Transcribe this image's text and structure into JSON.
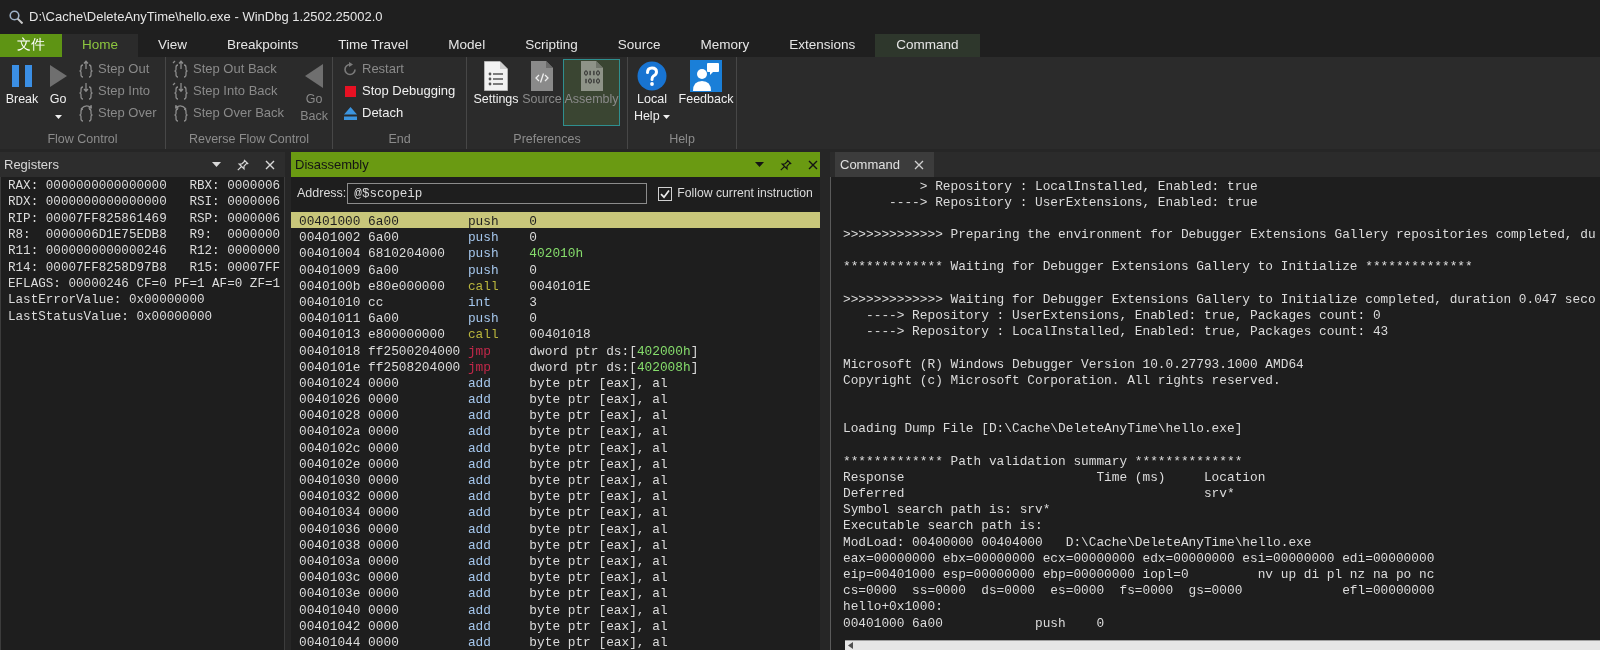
{
  "window": {
    "title": "D:\\Cache\\DeleteAnyTime\\hello.exe - WinDbg 1.2502.25002.0"
  },
  "ribbon": {
    "tabs": [
      {
        "label": "文件",
        "kind": "file",
        "selected": false
      },
      {
        "label": "Home",
        "kind": "normal",
        "selected": true
      },
      {
        "label": "View",
        "kind": "normal",
        "selected": false
      },
      {
        "label": "Breakpoints",
        "kind": "normal",
        "selected": false
      },
      {
        "label": "Time Travel",
        "kind": "normal",
        "selected": false
      },
      {
        "label": "Model",
        "kind": "normal",
        "selected": false
      },
      {
        "label": "Scripting",
        "kind": "normal",
        "selected": false
      },
      {
        "label": "Source",
        "kind": "normal",
        "selected": false
      },
      {
        "label": "Memory",
        "kind": "normal",
        "selected": false
      },
      {
        "label": "Extensions",
        "kind": "normal",
        "selected": false
      },
      {
        "label": "Command",
        "kind": "contextual",
        "selected": false
      }
    ],
    "groups": [
      {
        "label": "Flow Control",
        "buttons": [
          {
            "label": "Break",
            "kind": "large",
            "disabled": false,
            "dropdown": false,
            "checked": false
          },
          {
            "label": "Go",
            "kind": "large",
            "disabled": false,
            "dropdown": true,
            "checked": false
          },
          {
            "label": "Step Out",
            "kind": "small",
            "disabled": true,
            "dropdown": false,
            "checked": false
          },
          {
            "label": "Step Into",
            "kind": "small",
            "disabled": true,
            "dropdown": false,
            "checked": false
          },
          {
            "label": "Step Over",
            "kind": "small",
            "disabled": true,
            "dropdown": false,
            "checked": false
          }
        ]
      },
      {
        "label": "Reverse Flow Control",
        "buttons": [
          {
            "label": "Step Out Back",
            "kind": "small",
            "disabled": true,
            "dropdown": false,
            "checked": false
          },
          {
            "label": "Step Into Back",
            "kind": "small",
            "disabled": true,
            "dropdown": false,
            "checked": false
          },
          {
            "label": "Step Over Back",
            "kind": "small",
            "disabled": true,
            "dropdown": false,
            "checked": false
          },
          {
            "label": "Go Back",
            "kind": "large",
            "disabled": true,
            "dropdown": false,
            "checked": false
          }
        ]
      },
      {
        "label": "End",
        "buttons": [
          {
            "label": "Restart",
            "kind": "small",
            "disabled": true,
            "dropdown": false,
            "checked": false
          },
          {
            "label": "Stop Debugging",
            "kind": "small",
            "disabled": false,
            "dropdown": false,
            "checked": false
          },
          {
            "label": "Detach",
            "kind": "small",
            "disabled": false,
            "dropdown": false,
            "checked": false
          }
        ]
      },
      {
        "label": "Preferences",
        "buttons": [
          {
            "label": "Settings",
            "kind": "large",
            "disabled": false,
            "dropdown": false,
            "checked": false
          },
          {
            "label": "Source",
            "kind": "large",
            "disabled": true,
            "dropdown": false,
            "checked": false
          },
          {
            "label": "Assembly",
            "kind": "large",
            "disabled": true,
            "dropdown": false,
            "checked": true
          }
        ]
      },
      {
        "label": "Help",
        "buttons": [
          {
            "label": "Local Help",
            "kind": "large",
            "disabled": false,
            "dropdown": true,
            "checked": false
          },
          {
            "label": "Feedback",
            "kind": "large",
            "disabled": false,
            "dropdown": false,
            "checked": false
          }
        ]
      }
    ]
  },
  "registers": {
    "title": "Registers",
    "focused": false,
    "lines": [
      "RAX: 0000000000000000   RBX: 0000006",
      "RDX: 0000000000000000   RSI: 0000006",
      "RIP: 00007FF825861469   RSP: 0000006",
      "R8:  0000006D1E75EDB8   R9:  0000000",
      "R11: 0000000000000246   R12: 0000000",
      "R14: 00007FF8258D97B8   R15: 00007FF",
      "EFLAGS: 00000246 CF=0 PF=1 AF=0 ZF=1",
      "LastErrorValue: 0x00000000",
      "LastStatusValue: 0x00000000"
    ]
  },
  "disassembly": {
    "title": "Disassembly",
    "focused": true,
    "address": {
      "label": "Address:",
      "value": "@$scopeip"
    },
    "follow": {
      "label": "Follow current instruction",
      "checked": true
    },
    "rows": [
      {
        "address": "00401000",
        "bytes": "6a00",
        "mnemonic": "push",
        "kind": "basic",
        "operand": [
          {
            "text": "0",
            "kind": "plain"
          }
        ],
        "selected": true
      },
      {
        "address": "00401002",
        "bytes": "6a00",
        "mnemonic": "push",
        "kind": "basic",
        "operand": [
          {
            "text": "0",
            "kind": "plain"
          }
        ],
        "selected": false
      },
      {
        "address": "00401004",
        "bytes": "6810204000",
        "mnemonic": "push",
        "kind": "basic",
        "operand": [
          {
            "text": "402010h",
            "kind": "number"
          }
        ],
        "selected": false
      },
      {
        "address": "00401009",
        "bytes": "6a00",
        "mnemonic": "push",
        "kind": "basic",
        "operand": [
          {
            "text": "0",
            "kind": "plain"
          }
        ],
        "selected": false
      },
      {
        "address": "0040100b",
        "bytes": "e80e000000",
        "mnemonic": "call",
        "kind": "call",
        "operand": [
          {
            "text": "0040101E",
            "kind": "plain"
          }
        ],
        "selected": false
      },
      {
        "address": "00401010",
        "bytes": "cc",
        "mnemonic": "int",
        "kind": "basic",
        "operand": [
          {
            "text": "3",
            "kind": "plain"
          }
        ],
        "selected": false
      },
      {
        "address": "00401011",
        "bytes": "6a00",
        "mnemonic": "push",
        "kind": "basic",
        "operand": [
          {
            "text": "0",
            "kind": "plain"
          }
        ],
        "selected": false
      },
      {
        "address": "00401013",
        "bytes": "e800000000",
        "mnemonic": "call",
        "kind": "call",
        "operand": [
          {
            "text": "00401018",
            "kind": "plain"
          }
        ],
        "selected": false
      },
      {
        "address": "00401018",
        "bytes": "ff2500204000",
        "mnemonic": "jmp",
        "kind": "jump",
        "operand": [
          {
            "text": "dword ptr ds:[",
            "kind": "plain"
          },
          {
            "text": "402000h",
            "kind": "number"
          },
          {
            "text": "]",
            "kind": "plain"
          }
        ],
        "selected": false
      },
      {
        "address": "0040101e",
        "bytes": "ff2508204000",
        "mnemonic": "jmp",
        "kind": "jump",
        "operand": [
          {
            "text": "dword ptr ds:[",
            "kind": "plain"
          },
          {
            "text": "402008h",
            "kind": "number"
          },
          {
            "text": "]",
            "kind": "plain"
          }
        ],
        "selected": false
      },
      {
        "address": "00401024",
        "bytes": "0000",
        "mnemonic": "add",
        "kind": "basic",
        "operand": [
          {
            "text": "byte ptr [eax], al",
            "kind": "plain"
          }
        ],
        "selected": false
      },
      {
        "address": "00401026",
        "bytes": "0000",
        "mnemonic": "add",
        "kind": "basic",
        "operand": [
          {
            "text": "byte ptr [eax], al",
            "kind": "plain"
          }
        ],
        "selected": false
      },
      {
        "address": "00401028",
        "bytes": "0000",
        "mnemonic": "add",
        "kind": "basic",
        "operand": [
          {
            "text": "byte ptr [eax], al",
            "kind": "plain"
          }
        ],
        "selected": false
      },
      {
        "address": "0040102a",
        "bytes": "0000",
        "mnemonic": "add",
        "kind": "basic",
        "operand": [
          {
            "text": "byte ptr [eax], al",
            "kind": "plain"
          }
        ],
        "selected": false
      },
      {
        "address": "0040102c",
        "bytes": "0000",
        "mnemonic": "add",
        "kind": "basic",
        "operand": [
          {
            "text": "byte ptr [eax], al",
            "kind": "plain"
          }
        ],
        "selected": false
      },
      {
        "address": "0040102e",
        "bytes": "0000",
        "mnemonic": "add",
        "kind": "basic",
        "operand": [
          {
            "text": "byte ptr [eax], al",
            "kind": "plain"
          }
        ],
        "selected": false
      },
      {
        "address": "00401030",
        "bytes": "0000",
        "mnemonic": "add",
        "kind": "basic",
        "operand": [
          {
            "text": "byte ptr [eax], al",
            "kind": "plain"
          }
        ],
        "selected": false
      },
      {
        "address": "00401032",
        "bytes": "0000",
        "mnemonic": "add",
        "kind": "basic",
        "operand": [
          {
            "text": "byte ptr [eax], al",
            "kind": "plain"
          }
        ],
        "selected": false
      },
      {
        "address": "00401034",
        "bytes": "0000",
        "mnemonic": "add",
        "kind": "basic",
        "operand": [
          {
            "text": "byte ptr [eax], al",
            "kind": "plain"
          }
        ],
        "selected": false
      },
      {
        "address": "00401036",
        "bytes": "0000",
        "mnemonic": "add",
        "kind": "basic",
        "operand": [
          {
            "text": "byte ptr [eax], al",
            "kind": "plain"
          }
        ],
        "selected": false
      },
      {
        "address": "00401038",
        "bytes": "0000",
        "mnemonic": "add",
        "kind": "basic",
        "operand": [
          {
            "text": "byte ptr [eax], al",
            "kind": "plain"
          }
        ],
        "selected": false
      },
      {
        "address": "0040103a",
        "bytes": "0000",
        "mnemonic": "add",
        "kind": "basic",
        "operand": [
          {
            "text": "byte ptr [eax], al",
            "kind": "plain"
          }
        ],
        "selected": false
      },
      {
        "address": "0040103c",
        "bytes": "0000",
        "mnemonic": "add",
        "kind": "basic",
        "operand": [
          {
            "text": "byte ptr [eax], al",
            "kind": "plain"
          }
        ],
        "selected": false
      },
      {
        "address": "0040103e",
        "bytes": "0000",
        "mnemonic": "add",
        "kind": "basic",
        "operand": [
          {
            "text": "byte ptr [eax], al",
            "kind": "plain"
          }
        ],
        "selected": false
      },
      {
        "address": "00401040",
        "bytes": "0000",
        "mnemonic": "add",
        "kind": "basic",
        "operand": [
          {
            "text": "byte ptr [eax], al",
            "kind": "plain"
          }
        ],
        "selected": false
      },
      {
        "address": "00401042",
        "bytes": "0000",
        "mnemonic": "add",
        "kind": "basic",
        "operand": [
          {
            "text": "byte ptr [eax], al",
            "kind": "plain"
          }
        ],
        "selected": false
      },
      {
        "address": "00401044",
        "bytes": "0000",
        "mnemonic": "add",
        "kind": "basic",
        "operand": [
          {
            "text": "byte ptr [eax], al",
            "kind": "plain"
          }
        ],
        "selected": false
      }
    ]
  },
  "command": {
    "tab": {
      "label": "Command"
    },
    "lines": [
      {
        "kind": "output",
        "text": "          > Repository : LocalInstalled, Enabled: true"
      },
      {
        "kind": "output",
        "text": "      ----> Repository : UserExtensions, Enabled: true"
      },
      {
        "kind": "blank"
      },
      {
        "kind": "output",
        "text": ">>>>>>>>>>>>> Preparing the environment for Debugger Extensions Gallery repositories completed, du"
      },
      {
        "kind": "blank"
      },
      {
        "kind": "output",
        "text": "************* Waiting for Debugger Extensions Gallery to Initialize **************"
      },
      {
        "kind": "blank"
      },
      {
        "kind": "output",
        "text": ">>>>>>>>>>>>> Waiting for Debugger Extensions Gallery to Initialize completed, duration 0.047 seco"
      },
      {
        "kind": "output",
        "text": "   ----> Repository : UserExtensions, Enabled: true, Packages count: 0"
      },
      {
        "kind": "output",
        "text": "   ----> Repository : LocalInstalled, Enabled: true, Packages count: 43"
      },
      {
        "kind": "blank"
      },
      {
        "kind": "output",
        "text": "Microsoft (R) Windows Debugger Version 10.0.27793.1000 AMD64"
      },
      {
        "kind": "output",
        "text": "Copyright (c) Microsoft Corporation. All rights reserved."
      },
      {
        "kind": "blank"
      },
      {
        "kind": "blank"
      },
      {
        "kind": "output",
        "text": "Loading Dump File [D:\\Cache\\DeleteAnyTime\\hello.exe]"
      },
      {
        "kind": "blank"
      },
      {
        "kind": "output",
        "text": "************* Path validation summary **************"
      },
      {
        "kind": "output",
        "text": "Response                         Time (ms)     Location"
      },
      {
        "kind": "output",
        "text": "Deferred                                       srv*"
      },
      {
        "kind": "output",
        "text": "Symbol search path is: srv*"
      },
      {
        "kind": "output",
        "text": "Executable search path is:"
      },
      {
        "kind": "output",
        "text": "ModLoad: 00400000 00404000   D:\\Cache\\DeleteAnyTime\\hello.exe"
      },
      {
        "kind": "output",
        "text": "eax=00000000 ebx=00000000 ecx=00000000 edx=00000000 esi=00000000 edi=00000000"
      },
      {
        "kind": "output",
        "text": "eip=00401000 esp=00000000 ebp=00000000 iopl=0         nv up di pl nz na po nc"
      },
      {
        "kind": "output",
        "text": "cs=0000  ss=0000  ds=0000  es=0000  fs=0000  gs=0000             efl=00000000"
      },
      {
        "kind": "output",
        "text": "hello+0x1000:"
      },
      {
        "kind": "output",
        "text": "00401000 6a00            push    0"
      }
    ]
  }
}
